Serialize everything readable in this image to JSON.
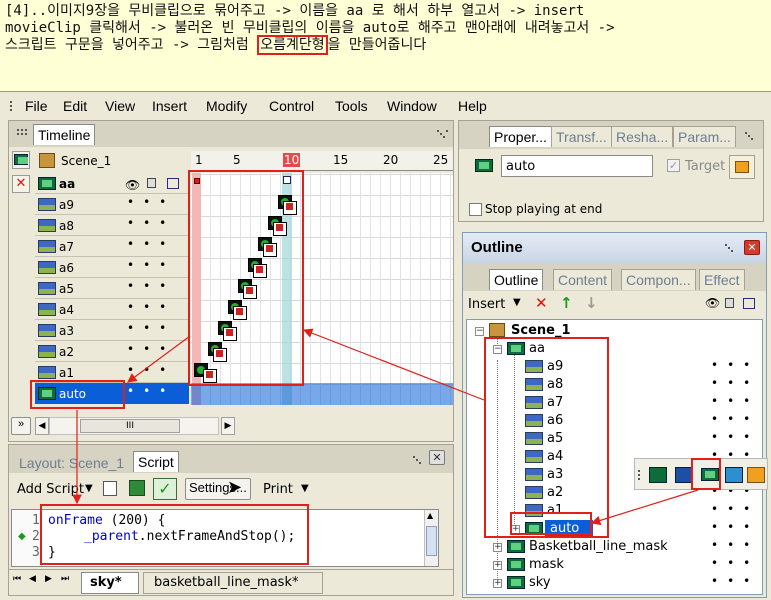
{
  "note": {
    "lines": [
      "[4]..이미지9장을 무비클립으로 묶어주고 -> 이름을 aa 로 해서 하부 열고서 -> insert",
      "movieClip 클릭해서 -> 불러온 빈 무비클립의 이름을 auto로 해주고 맨아래에 내려놓고서 ->"
    ],
    "line3_pre": "스크립트 구문을 넣어주고 -> 그림처럼 ",
    "line3_highlight": "오름계단형",
    "line3_post": "을 만들어줍니다"
  },
  "menu": [
    "File",
    "Edit",
    "View",
    "Insert",
    "Modify",
    "Control",
    "Tools",
    "Window",
    "Help"
  ],
  "timeline": {
    "tab": "Timeline",
    "scene": "Scene_1",
    "ruler": [
      "1",
      "5",
      "10",
      "15",
      "20",
      "25"
    ],
    "layers": [
      "aa",
      "a9",
      "a8",
      "a7",
      "a6",
      "a5",
      "a4",
      "a3",
      "a2",
      "a1",
      "auto"
    ],
    "expand_btn": "»",
    "scroll_mark": "III"
  },
  "properties": {
    "tabs": [
      "Proper...",
      "Transf...",
      "Resha...",
      "Param..."
    ],
    "name_value": "auto",
    "target_label": "Target",
    "stop_label": "Stop playing at end"
  },
  "outline": {
    "title": "Outline",
    "tabs": [
      "Outline",
      "Content",
      "Compon...",
      "Effect"
    ],
    "insert_label": "Insert",
    "tree": [
      {
        "label": "Scene_1",
        "level": 0,
        "bold": true
      },
      {
        "label": "aa",
        "level": 1
      },
      {
        "label": "a9",
        "level": 2
      },
      {
        "label": "a8",
        "level": 2
      },
      {
        "label": "a7",
        "level": 2
      },
      {
        "label": "a6",
        "level": 2
      },
      {
        "label": "a5",
        "level": 2
      },
      {
        "label": "a4",
        "level": 2
      },
      {
        "label": "a3",
        "level": 2
      },
      {
        "label": "a2",
        "level": 2
      },
      {
        "label": "a1",
        "level": 2
      },
      {
        "label": "auto",
        "level": 2,
        "selected": true
      },
      {
        "label": "Basketball_line_mask",
        "level": 1
      },
      {
        "label": "mask",
        "level": 1
      },
      {
        "label": "sky",
        "level": 1
      }
    ]
  },
  "script": {
    "tabs": [
      "Layout: Scene_1",
      "Script"
    ],
    "add_script": "Add Script",
    "settings": "Settings...",
    "print": "Print",
    "line_numbers": [
      "1",
      "2",
      "3"
    ],
    "line1_kw": "onFrame",
    "line1_rest": " (200) {",
    "line2_kw": "_parent",
    "line2_rest": ".nextFrameAndStop();",
    "line3": "}",
    "bottom_tabs": [
      "sky*",
      "basketball_line_mask*"
    ]
  },
  "colors": {
    "red": "#e0201a",
    "accent": "#0a5fd8"
  }
}
